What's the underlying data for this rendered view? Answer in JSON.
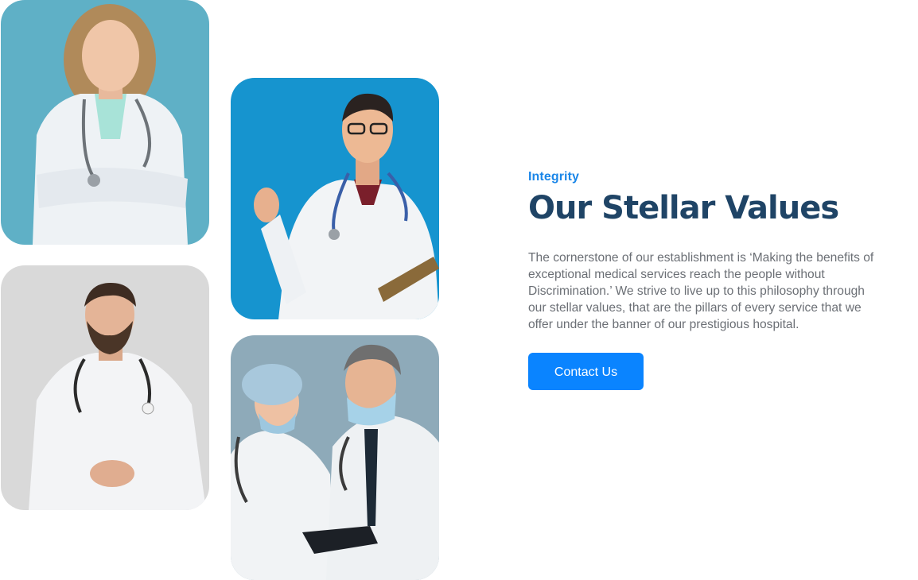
{
  "section": {
    "eyebrow": "Integrity",
    "title": "Our Stellar Values",
    "body": "The cornerstone of our establishment is ‘Making the benefits of exceptional medical services reach the people without Discrimination.’ We strive to live up to this philosophy through our stellar values, that are the pillars of every service that we offer under the banner of our prestigious hospital.",
    "cta_label": "Contact Us"
  },
  "colors": {
    "accent": "#0a84ff",
    "eyebrow": "#1a86e8",
    "heading": "#1f4466",
    "body": "#6b6f75"
  },
  "photos": [
    {
      "subject": "female-doctor-arms-crossed",
      "background": "#5fb0c6"
    },
    {
      "subject": "male-doctor-pointing-with-folder",
      "background": "#1694cf"
    },
    {
      "subject": "bearded-doctor-hands-clasped",
      "background": "#d9d9d9"
    },
    {
      "subject": "two-masked-doctors-with-clipboard",
      "background": "#8eaab9"
    }
  ]
}
